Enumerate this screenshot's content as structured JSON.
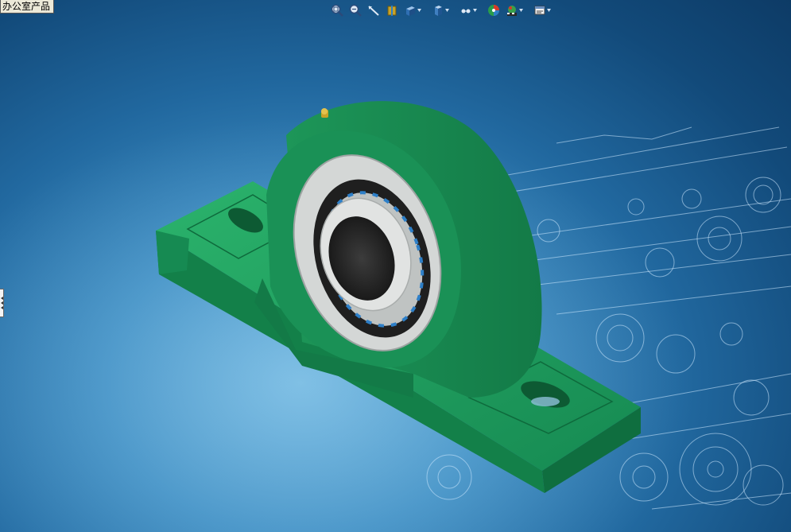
{
  "office_tab": {
    "label": "办公室产品"
  },
  "toolbar": {
    "buttons": [
      {
        "name": "zoom-to-fit-icon"
      },
      {
        "name": "zoom-to-area-icon"
      },
      {
        "name": "previous-view-icon"
      },
      {
        "name": "section-view-icon"
      },
      {
        "name": "view-orientation-icon"
      },
      {
        "name": "display-style-icon"
      },
      {
        "name": "hide-show-items-icon"
      },
      {
        "name": "edit-appearance-icon"
      },
      {
        "name": "apply-scene-icon"
      },
      {
        "name": "view-settings-icon"
      }
    ]
  },
  "model": {
    "description_colors": {
      "housing": "#1f9a5c",
      "housing_dark": "#12774a",
      "ring": "#cfd2d2",
      "bore": "#2e2e2e",
      "balls": "#2d7fc8",
      "grease_fitting": "#c9a227"
    }
  },
  "background": {
    "accent": "#2f7fb8"
  }
}
